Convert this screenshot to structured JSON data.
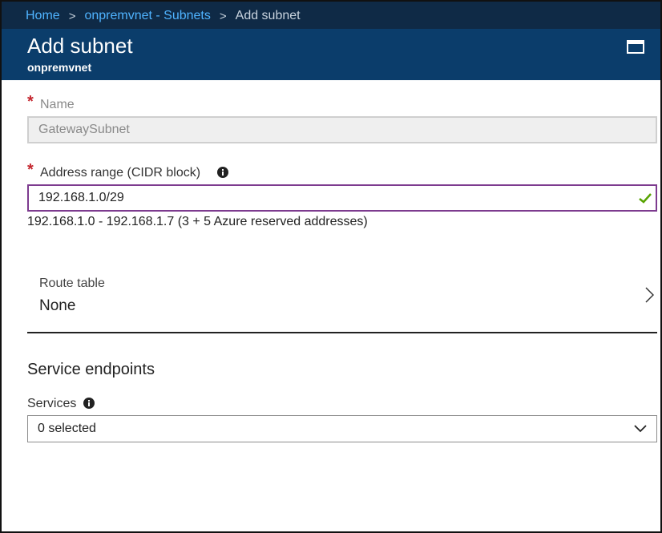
{
  "breadcrumb": {
    "items": [
      {
        "label": "Home"
      },
      {
        "label": "onpremvnet - Subnets"
      }
    ],
    "separator": ">",
    "current": "Add subnet"
  },
  "header": {
    "title": "Add subnet",
    "subtitle": "onpremvnet",
    "maximize_icon": "maximize-icon"
  },
  "form": {
    "required_marker": "*",
    "name": {
      "label": "Name",
      "value": "GatewaySubnet"
    },
    "address_range": {
      "label": "Address range (CIDR block)",
      "value": "192.168.1.0/29",
      "hint": "192.168.1.0 - 192.168.1.7 (3 + 5 Azure reserved addresses)"
    },
    "route_table": {
      "label": "Route table",
      "value": "None"
    },
    "service_endpoints": {
      "heading": "Service endpoints",
      "services_label": "Services",
      "services_value": "0 selected"
    }
  },
  "colors": {
    "breadcrumb_bg": "#0f2a46",
    "header_bg": "#0b3d6b",
    "link": "#4fb3ff",
    "required": "#c4262e",
    "valid_check": "#57a300",
    "focus_border": "#7d3b8f"
  }
}
